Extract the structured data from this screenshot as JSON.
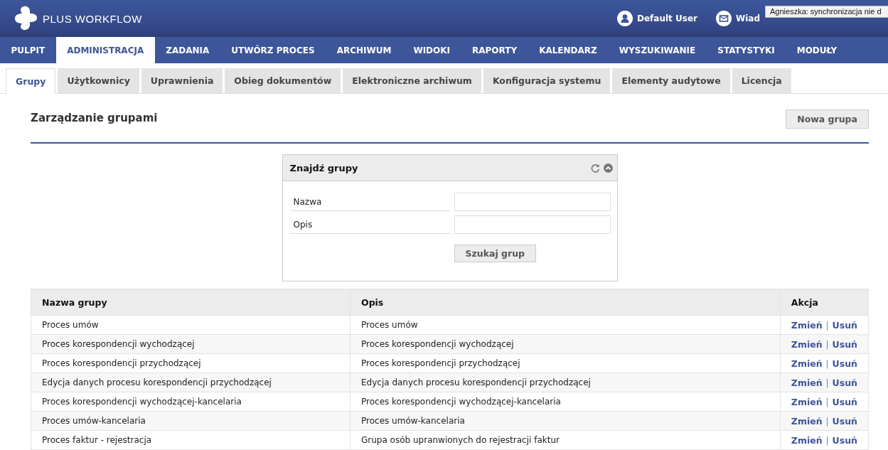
{
  "header": {
    "logo": "PLUS WORKFLOW",
    "user": "Default User",
    "messages": "Wiad",
    "tooltip": "Agnieszka: synchronizacja nie d"
  },
  "menu": [
    {
      "label": "PULPIT",
      "selected": false
    },
    {
      "label": "ADMINISTRACJA",
      "selected": true
    },
    {
      "label": "ZADANIA",
      "selected": false
    },
    {
      "label": "UTWÓRZ PROCES",
      "selected": false
    },
    {
      "label": "ARCHIWUM",
      "selected": false
    },
    {
      "label": "WIDOKI",
      "selected": false
    },
    {
      "label": "RAPORTY",
      "selected": false
    },
    {
      "label": "KALENDARZ",
      "selected": false
    },
    {
      "label": "WYSZUKIWANIE",
      "selected": false
    },
    {
      "label": "STATYSTYKI",
      "selected": false
    },
    {
      "label": "MODUŁY",
      "selected": false
    }
  ],
  "tabs": [
    {
      "label": "Grupy",
      "selected": true
    },
    {
      "label": "Użytkownicy",
      "selected": false
    },
    {
      "label": "Uprawnienia",
      "selected": false
    },
    {
      "label": "Obieg dokumentów",
      "selected": false
    },
    {
      "label": "Elektroniczne archiwum",
      "selected": false
    },
    {
      "label": "Konfiguracja systemu",
      "selected": false
    },
    {
      "label": "Elementy audytowe",
      "selected": false
    },
    {
      "label": "Licencja",
      "selected": false
    }
  ],
  "page": {
    "title": "Zarządzanie grupami",
    "new_button": "Nowa grupa"
  },
  "search": {
    "title": "Znajdź grupy",
    "fields": [
      {
        "label": "Nazwa"
      },
      {
        "label": "Opis"
      }
    ],
    "button": "Szukaj grup"
  },
  "table": {
    "columns": [
      "Nazwa grupy",
      "Opis",
      "Akcja"
    ],
    "rows": [
      {
        "name": "Proces umów",
        "description": "Proces umów",
        "edit": "Zmień",
        "separator": "|",
        "delete": "Usuń"
      },
      {
        "name": "Proces korespondencji wychodzącej",
        "description": "Proces korespondencji wychodzącej",
        "edit": "Zmień",
        "separator": "|",
        "delete": "Usuń"
      },
      {
        "name": "Proces korespondencji przychodzącej",
        "description": "Proces korespondencji przychodzącej",
        "edit": "Zmień",
        "separator": "|",
        "delete": "Usuń"
      },
      {
        "name": "Edycja danych procesu korespondencji przychodzącej",
        "description": "Edycja danych procesu korespondencji przychodzącej",
        "edit": "Zmień",
        "separator": "|",
        "delete": "Usuń"
      },
      {
        "name": "Proces korespondencji wychodzącej-kancelaria",
        "description": "Proces korespondencji wychodzącej-kancelaria",
        "edit": "Zmień",
        "separator": "|",
        "delete": "Usuń"
      },
      {
        "name": "Proces umów-kancelaria",
        "description": "Proces umów-kancelaria",
        "edit": "Zmień",
        "separator": "|",
        "delete": "Usuń"
      },
      {
        "name": "Proces faktur - rejestracja",
        "description": "Grupa osób upranwionych do rejestracji faktur",
        "edit": "Zmień",
        "separator": "|",
        "delete": "Usuń"
      }
    ]
  }
}
